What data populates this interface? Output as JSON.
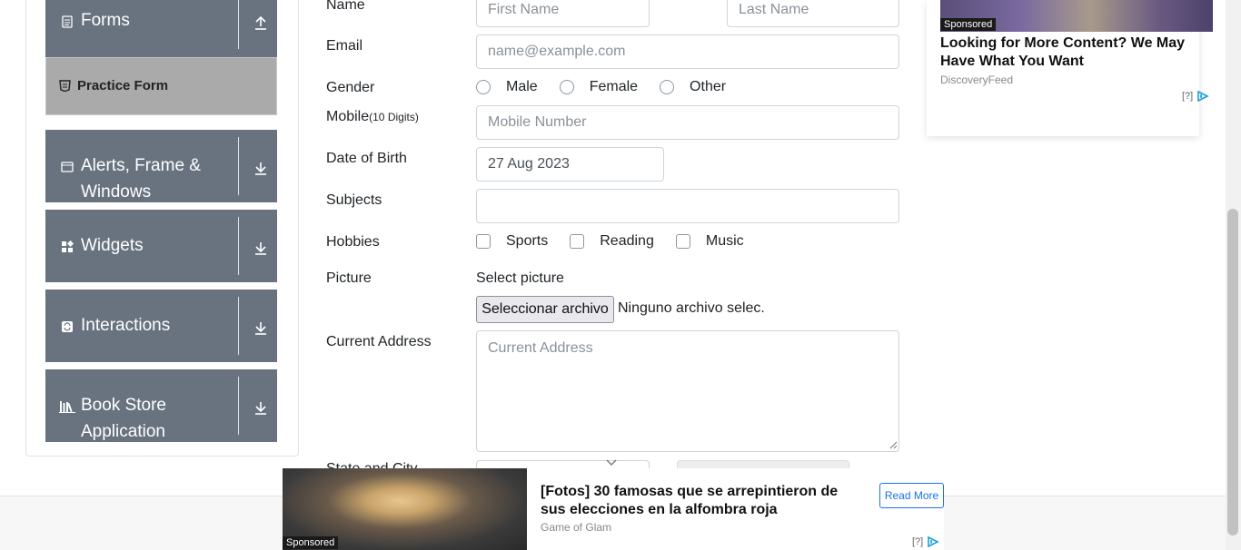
{
  "sidebar": {
    "groups": [
      {
        "label": "Forms"
      },
      {
        "label": "Alerts, Frame &",
        "label2": "Windows"
      },
      {
        "label": "Widgets"
      },
      {
        "label": "Interactions"
      },
      {
        "label": "Book Store",
        "label2": "Application"
      }
    ],
    "active_item": "Practice Form"
  },
  "form": {
    "name_label": "Name",
    "first_name_placeholder": "First Name",
    "last_name_placeholder": "Last Name",
    "email_label": "Email",
    "email_placeholder": "name@example.com",
    "gender_label": "Gender",
    "gender_options": [
      "Male",
      "Female",
      "Other"
    ],
    "mobile_label": "Mobile",
    "mobile_hint": "(10 Digits)",
    "mobile_placeholder": "Mobile Number",
    "dob_label": "Date of Birth",
    "dob_value": "27 Aug 2023",
    "subjects_label": "Subjects",
    "hobbies_label": "Hobbies",
    "hobby_options": [
      "Sports",
      "Reading",
      "Music"
    ],
    "picture_label": "Picture",
    "picture_hint": "Select picture",
    "file_button": "Seleccionar archivo",
    "file_status": "Ninguno archivo selec.",
    "address_label": "Current Address",
    "address_placeholder": "Current Address",
    "state_city_label": "State and City"
  },
  "ad_right": {
    "tag": "Sponsored",
    "headline": "Looking for More Content? We May Have What You Want",
    "source": "DiscoveryFeed",
    "choice": "[?]"
  },
  "ad_bottom": {
    "tag": "Sponsored",
    "headline": "[Fotos] 30 famosas que se arrepintieron de sus elecciones en la alfombra roja",
    "source": "Game of Glam",
    "cta": "Read More",
    "choice": "[?]"
  },
  "colors": {
    "group_header_bg": "#697380",
    "practice_bg": "#aaaaaa",
    "link_blue": "#1a73e8"
  }
}
